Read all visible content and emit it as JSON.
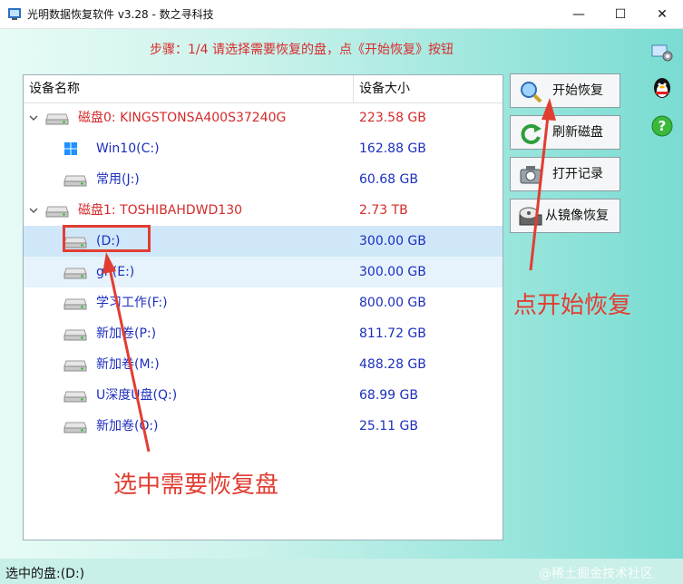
{
  "window": {
    "title": "光明数据恢复软件 v3.28 - 数之寻科技",
    "minimize_glyph": "—",
    "maximize_glyph": "☐",
    "close_glyph": "✕"
  },
  "step_text": "步骤：1/4 请选择需要恢复的盘，点《开始恢复》按钮",
  "list": {
    "columns": [
      "设备名称",
      "设备大小"
    ],
    "rows": [
      {
        "kind": "disk",
        "name": "磁盘0: KINGSTONSA400S37240G",
        "size": "223.58 GB",
        "icon": "hard-disk-icon"
      },
      {
        "kind": "part",
        "name": "Win10(C:)",
        "size": "162.88 GB",
        "icon": "windows-logo-icon"
      },
      {
        "kind": "part",
        "name": "常用(J:)",
        "size": "60.68 GB",
        "icon": "drive-icon"
      },
      {
        "kind": "disk",
        "name": "磁盘1: TOSHIBAHDWD130",
        "size": "2.73 TB",
        "icon": "hard-disk-icon"
      },
      {
        "kind": "part",
        "name": "(D:)",
        "size": "300.00 GB",
        "icon": "drive-icon",
        "state": "selected"
      },
      {
        "kind": "part",
        "name": "gh(E:)",
        "size": "300.00 GB",
        "icon": "drive-icon",
        "state": "hover"
      },
      {
        "kind": "part",
        "name": "学习工作(F:)",
        "size": "800.00 GB",
        "icon": "drive-icon"
      },
      {
        "kind": "part",
        "name": "新加卷(P:)",
        "size": "811.72 GB",
        "icon": "drive-icon"
      },
      {
        "kind": "part",
        "name": "新加卷(M:)",
        "size": "488.28 GB",
        "icon": "drive-icon"
      },
      {
        "kind": "part",
        "name": "U深度U盘(Q:)",
        "size": "68.99 GB",
        "icon": "drive-icon"
      },
      {
        "kind": "part",
        "name": "新加卷(O:)",
        "size": "25.11 GB",
        "icon": "drive-icon"
      }
    ]
  },
  "buttons": {
    "start": "开始恢复",
    "refresh": "刷新磁盘",
    "open_record": "打开记录",
    "from_image": "从镜像恢复"
  },
  "side_icons": [
    "settings-icon",
    "qq-penguin-icon",
    "help-icon"
  ],
  "annotations": {
    "click_start": "点开始恢复",
    "select_disk": "选中需要恢复盘"
  },
  "status": {
    "selected": "选中的盘:(D:)",
    "watermark": "@稀土掘金技术社区"
  },
  "colors": {
    "disk_text": "#d42b2b",
    "partition_text": "#1d2fbf",
    "annotation": "#e23d32",
    "selected_row": "#cfe7f9"
  }
}
